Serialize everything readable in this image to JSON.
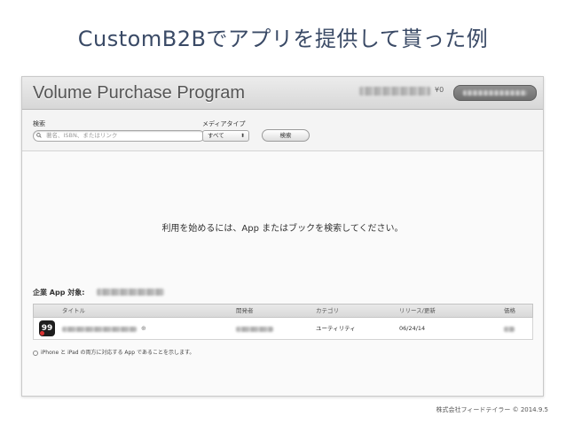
{
  "slide": {
    "title": "CustomB2Bでアプリを提供して貰った例",
    "footer": "株式会社フィードテイラー © 2014.9.5"
  },
  "vpp": {
    "header": {
      "title": "Volume Purchase Program",
      "currency": "¥0"
    },
    "search": {
      "search_label": "検索",
      "search_placeholder": "著名、ISBN、またはリンク",
      "media_label": "メディアタイプ",
      "media_selected": "すべて",
      "search_button": "検索"
    },
    "empty_message": "利用を始めるには、App またはブックを検索してください。",
    "enterprise_label": "企業 App 対象:",
    "table": {
      "columns": [
        "タイトル",
        "開発者",
        "カテゴリ",
        "リリース/更新",
        "価格"
      ],
      "rows": [
        {
          "icon_text": "99",
          "category": "ユーティリティ",
          "release": "06/24/14"
        }
      ]
    },
    "footnote": "iPhone と iPad の両方に対応する App であることを示します。"
  },
  "colors": {
    "title": "#3a4a66",
    "header_bg": "#d7d7d7",
    "content_bg": "#fafafa"
  }
}
